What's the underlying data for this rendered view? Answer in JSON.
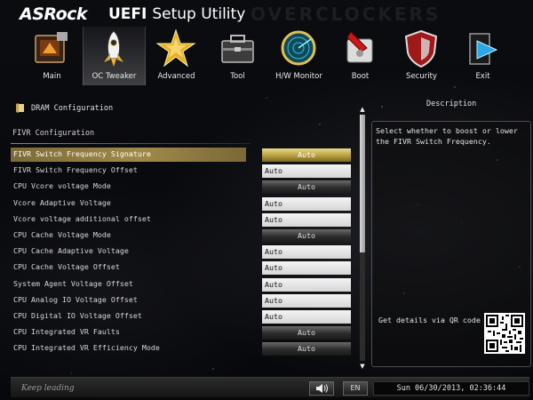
{
  "header": {
    "brand": "ASRock",
    "title_bold": "UEFI",
    "title_rest": "Setup Utility",
    "watermark": "OVERCLOCKERS"
  },
  "nav": {
    "tabs": [
      {
        "label": "Main",
        "icon": "main-icon",
        "active": false
      },
      {
        "label": "OC Tweaker",
        "icon": "rocket-icon",
        "active": true
      },
      {
        "label": "Advanced",
        "icon": "star-icon",
        "active": false
      },
      {
        "label": "Tool",
        "icon": "toolbox-icon",
        "active": false
      },
      {
        "label": "H/W Monitor",
        "icon": "radar-icon",
        "active": false
      },
      {
        "label": "Boot",
        "icon": "boot-icon",
        "active": false
      },
      {
        "label": "Security",
        "icon": "shield-icon",
        "active": false
      },
      {
        "label": "Exit",
        "icon": "exit-icon",
        "active": false
      }
    ]
  },
  "breadcrumb": "DRAM Configuration",
  "section_title": "FIVR Configuration",
  "settings": [
    {
      "label": "FIVR Switch Frequency Signature",
      "value": "Auto",
      "kind": "drop",
      "selected": true
    },
    {
      "label": "FIVR Switch Frequency Offset",
      "value": "Auto",
      "kind": "text",
      "selected": false
    },
    {
      "label": "CPU Vcore voltage Mode",
      "value": "Auto",
      "kind": "drop",
      "selected": false
    },
    {
      "label": "Vcore Adaptive Voltage",
      "value": "Auto",
      "kind": "text",
      "selected": false
    },
    {
      "label": "Vcore voltage additional offset",
      "value": "Auto",
      "kind": "text",
      "selected": false
    },
    {
      "label": "CPU Cache Voltage Mode",
      "value": "Auto",
      "kind": "drop",
      "selected": false
    },
    {
      "label": "CPU Cache Adaptive Voltage",
      "value": "Auto",
      "kind": "text",
      "selected": false
    },
    {
      "label": "CPU Cache Voltage Offset",
      "value": "Auto",
      "kind": "text",
      "selected": false
    },
    {
      "label": "System Agent Voltage Offset",
      "value": "Auto",
      "kind": "text",
      "selected": false
    },
    {
      "label": "CPU Analog IO Voltage Offset",
      "value": "Auto",
      "kind": "text",
      "selected": false
    },
    {
      "label": "CPU Digital IO Voltage Offset",
      "value": "Auto",
      "kind": "text",
      "selected": false
    },
    {
      "label": "CPU Integrated VR Faults",
      "value": "Auto",
      "kind": "drop",
      "selected": false
    },
    {
      "label": "CPU Integrated VR Efficiency Mode",
      "value": "Auto",
      "kind": "drop",
      "selected": false
    }
  ],
  "description": {
    "title": "Description",
    "text": "Select whether to boost or lower the FIVR Switch Frequency.",
    "qr_label": "Get details via QR code"
  },
  "footer": {
    "slogan": "Keep leading",
    "language": "EN",
    "datetime": "Sun 06/30/2013, 02:36:44"
  },
  "colors": {
    "selected_row": "#9a8444",
    "selected_value": "#c8b055",
    "background": "#07080b"
  }
}
